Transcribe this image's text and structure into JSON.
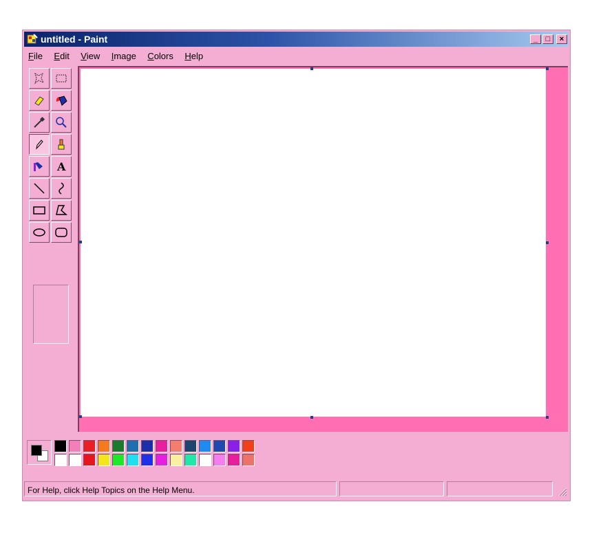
{
  "window": {
    "title": "untitled - Paint",
    "minimize_label": "_",
    "maximize_label": "□",
    "close_label": "×"
  },
  "menu": {
    "items": [
      {
        "label": "File",
        "accel": "F",
        "rest": "ile"
      },
      {
        "label": "Edit",
        "accel": "E",
        "rest": "dit"
      },
      {
        "label": "View",
        "accel": "V",
        "rest": "iew"
      },
      {
        "label": "Image",
        "accel": "I",
        "rest": "mage"
      },
      {
        "label": "Colors",
        "accel": "C",
        "rest": "olors"
      },
      {
        "label": "Help",
        "accel": "H",
        "rest": "elp"
      }
    ]
  },
  "tools": [
    {
      "name": "free-form-select-icon"
    },
    {
      "name": "select-icon"
    },
    {
      "name": "eraser-icon"
    },
    {
      "name": "fill-with-color-icon"
    },
    {
      "name": "pick-color-icon"
    },
    {
      "name": "magnifier-icon"
    },
    {
      "name": "pencil-icon",
      "selected": true
    },
    {
      "name": "brush-icon"
    },
    {
      "name": "airbrush-icon"
    },
    {
      "name": "text-icon",
      "glyph": "A"
    },
    {
      "name": "line-icon"
    },
    {
      "name": "curve-icon"
    },
    {
      "name": "rectangle-icon"
    },
    {
      "name": "polygon-icon"
    },
    {
      "name": "ellipse-icon"
    },
    {
      "name": "rounded-rectangle-icon"
    }
  ],
  "colors": {
    "foreground": "#000000",
    "background": "#ffffff",
    "palette_top": [
      "#000000",
      "#f47eb8",
      "#e81f24",
      "#f47a20",
      "#1a7a2e",
      "#1f6fb0",
      "#1c2fa8",
      "#e81fa0",
      "#f47e6e",
      "#1e4470",
      "#1f8af0",
      "#1f48b0",
      "#8a1fe8",
      "#f0401a"
    ],
    "palette_bottom": [
      "#ffffff",
      "#ffffff",
      "#e8141e",
      "#f5e61a",
      "#1fe82a",
      "#1fe0f0",
      "#1f30e8",
      "#e81fe0",
      "#f8f0a0",
      "#1fe8a8",
      "#ffffff",
      "#f47ef0",
      "#e81f9a",
      "#f0706a"
    ]
  },
  "status": {
    "help_text": "For Help, click Help Topics on the Help Menu.",
    "pane2": "",
    "pane3": ""
  }
}
